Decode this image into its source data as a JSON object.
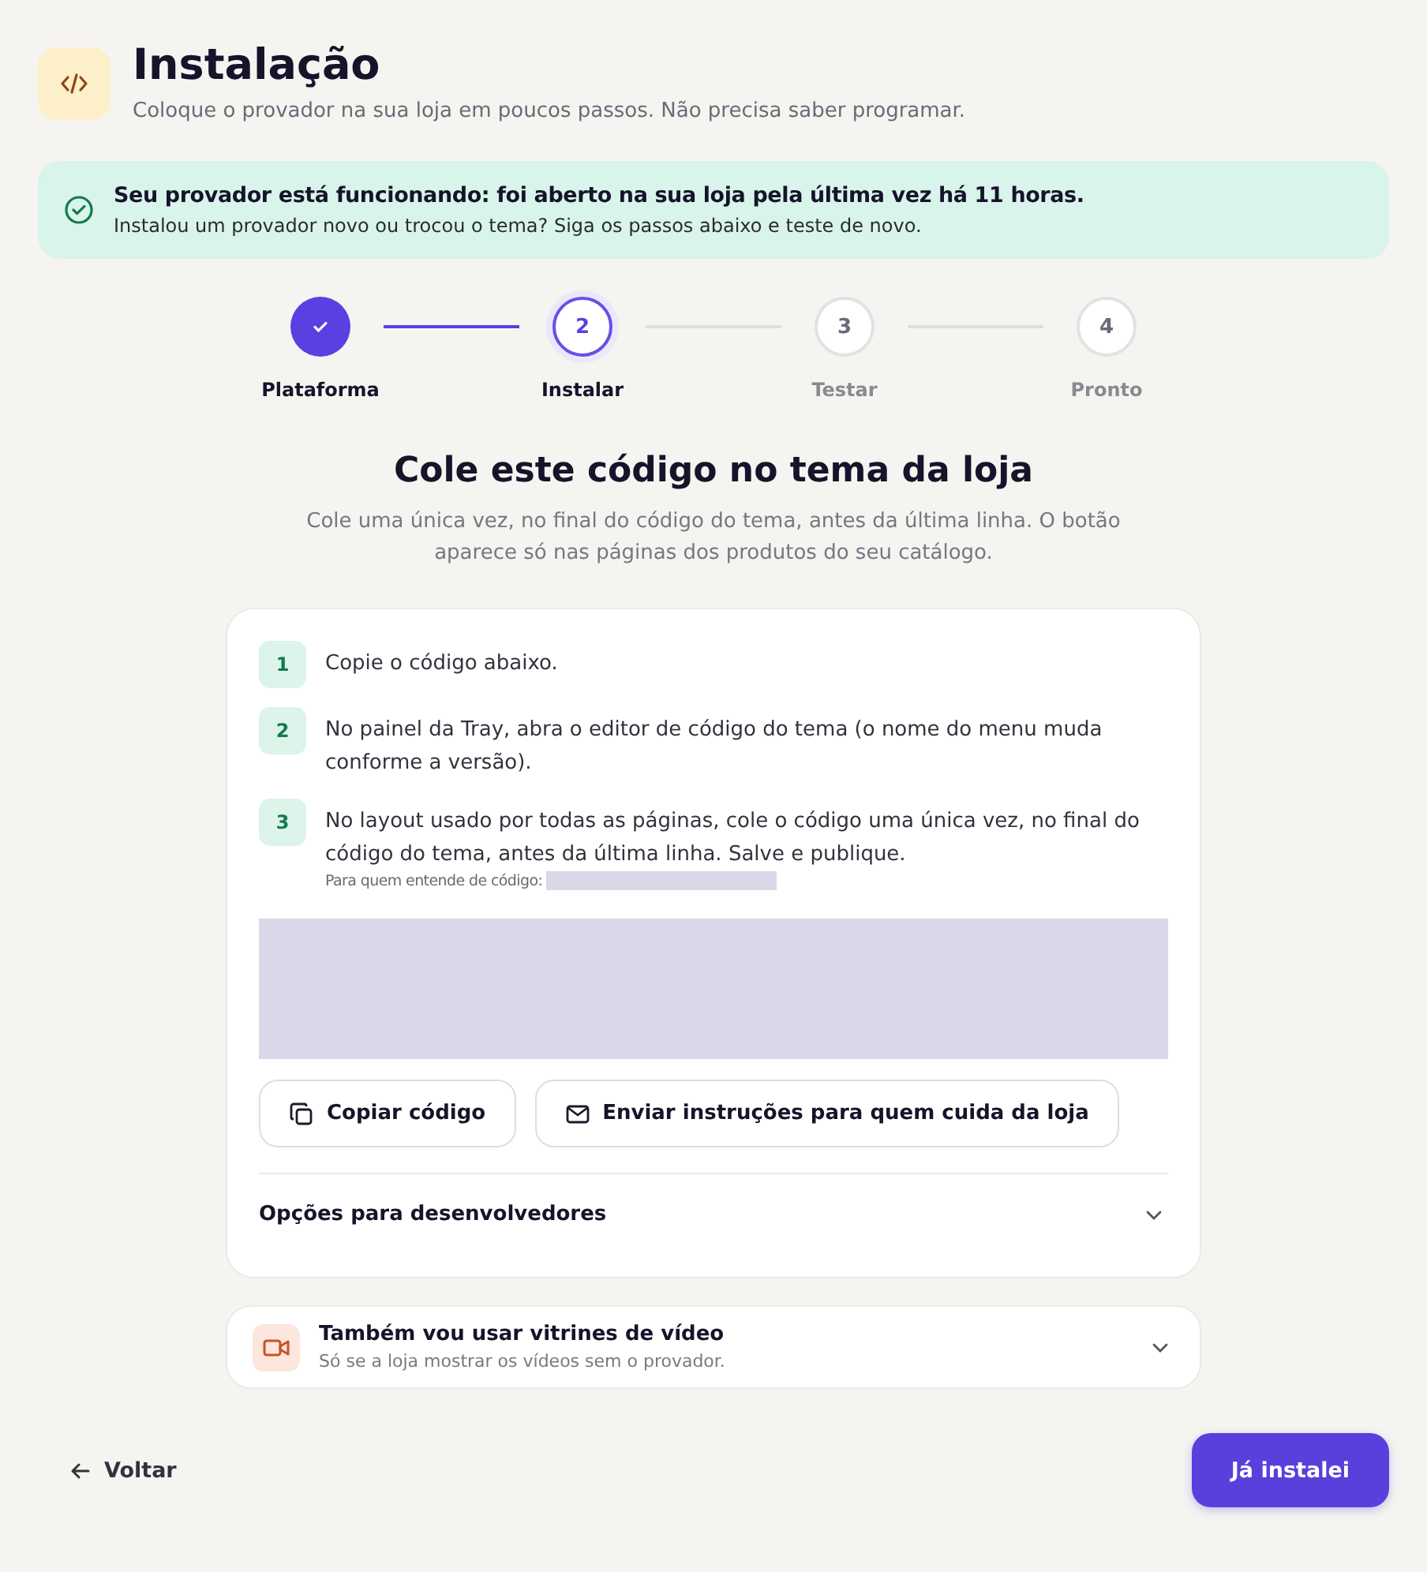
{
  "header": {
    "title": "Instalação",
    "subtitle": "Coloque o provador na sua loja em poucos passos. Não precisa saber programar."
  },
  "banner": {
    "title": "Seu provador está funcionando: foi aberto na sua loja pela última vez há 11 horas.",
    "text": "Instalou um provador novo ou trocou o tema? Siga os passos abaixo e teste de novo."
  },
  "stepper": [
    {
      "label": "Plataforma",
      "done": true,
      "selected": false
    },
    {
      "number": "2",
      "label": "Instalar",
      "done": false,
      "selected": true
    },
    {
      "number": "3",
      "label": "Testar",
      "done": false,
      "selected": false
    },
    {
      "number": "4",
      "label": "Pronto",
      "done": false,
      "selected": false
    }
  ],
  "section": {
    "title": "Cole este código no tema da loja",
    "text": "Cole uma única vez, no final do código do tema, antes da última linha. O botão aparece só nas páginas dos produtos do seu catálogo."
  },
  "instructions": [
    {
      "number": "1",
      "text": "Copie o código abaixo."
    },
    {
      "number": "2",
      "text": "No painel da Tray, abra o editor de código do tema (o nome do menu muda conforme a versão)."
    },
    {
      "number": "3",
      "text": "No layout usado por todas as páginas, cole o código uma única vez, no final do código do tema, antes da última linha. Salve e publique.",
      "note": "Para quem entende de código:"
    }
  ],
  "buttons": [
    {
      "kind": "copy",
      "label": "Copiar código"
    },
    {
      "kind": "mail",
      "label": "Enviar instruções para quem cuida da loja"
    }
  ],
  "developer_options": {
    "label": "Opções para desenvolvedores",
    "expanded": false
  },
  "video_option": {
    "title": "Também vou usar vitrines de vídeo",
    "text": "Só se a loja mostrar os vídeos sem o provador.",
    "expanded": false
  },
  "footer": {
    "back": "Voltar",
    "next": "Já instalei"
  }
}
